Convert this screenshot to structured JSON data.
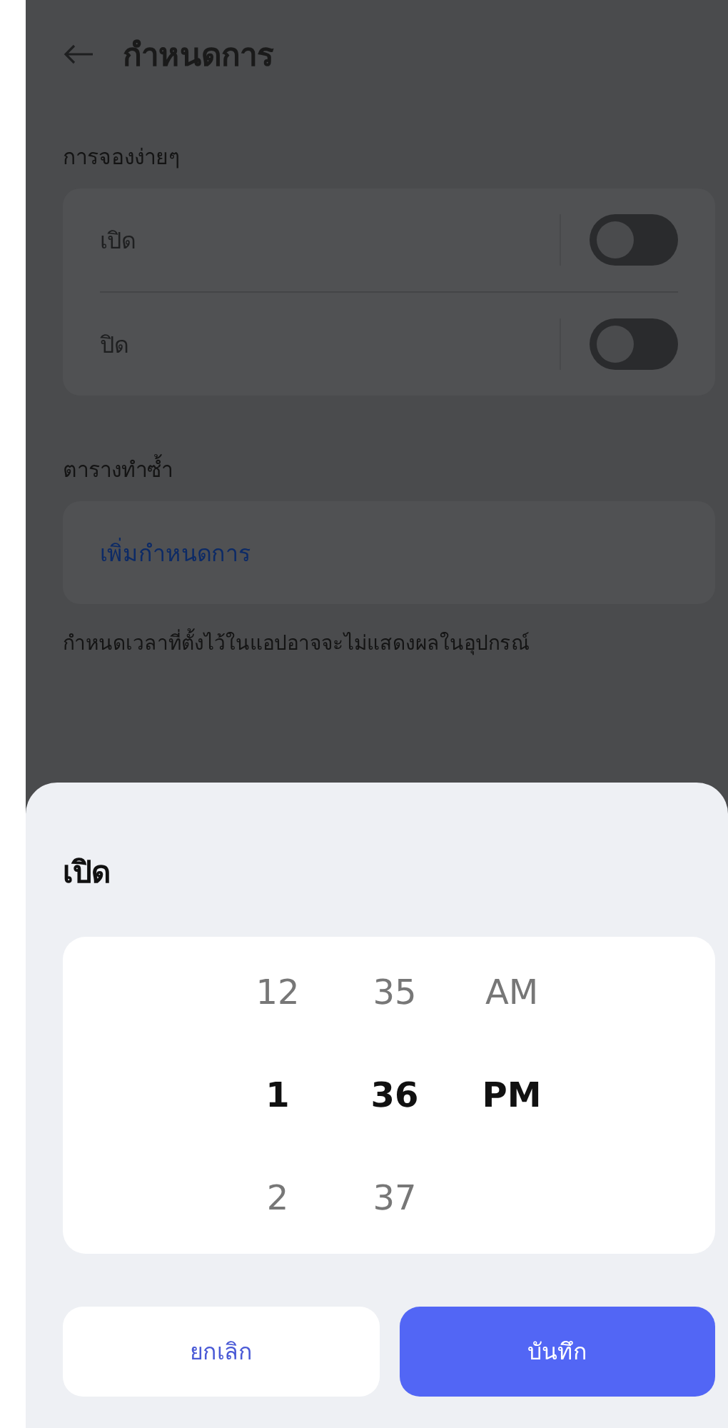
{
  "header": {
    "title": "กำหนดการ"
  },
  "quick_booking": {
    "label": "การจองง่ายๆ",
    "rows": [
      {
        "label": "เปิด",
        "on": false
      },
      {
        "label": "ปิด",
        "on": false
      }
    ]
  },
  "repeat_schedule": {
    "label": "ตารางทำซ้ำ",
    "add_link": "เพิ่มกำหนดการ",
    "note": "กำหนดเวลาที่ตั้งไว้ในแอปอาจจะไม่แสดงผลในอุปกรณ์"
  },
  "sheet": {
    "title": "เปิด",
    "picker_columns": [
      {
        "items": [
          {
            "text": "12",
            "selected": false
          },
          {
            "text": "1",
            "selected": true
          },
          {
            "text": "2",
            "selected": false
          }
        ]
      },
      {
        "items": [
          {
            "text": "35",
            "selected": false
          },
          {
            "text": "36",
            "selected": true
          },
          {
            "text": "37",
            "selected": false
          }
        ]
      },
      {
        "items": [
          {
            "text": "AM",
            "selected": false
          },
          {
            "text": "PM",
            "selected": true
          }
        ]
      }
    ],
    "buttons": [
      {
        "label": "ยกเลิก",
        "kind": "secondary"
      },
      {
        "label": "บันทึก",
        "kind": "primary"
      }
    ]
  }
}
